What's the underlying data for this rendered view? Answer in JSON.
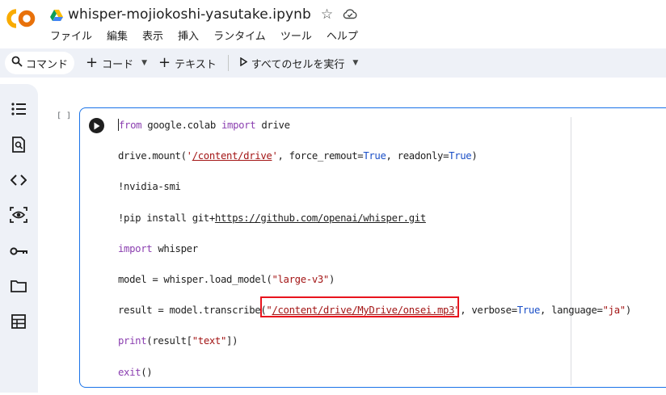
{
  "app": {
    "logo_text": "CO",
    "notebook_title": "whisper-mojiokoshi-yasutake.ipynb"
  },
  "menu": [
    "ファイル",
    "編集",
    "表示",
    "挿入",
    "ランタイム",
    "ツール",
    "ヘルプ"
  ],
  "toolbar": {
    "command_label": "コマンド",
    "add_code_label": "コード",
    "add_text_label": "テキスト",
    "run_all_label": "すべてのセルを実行"
  },
  "sidebar": {
    "icons": [
      "toc-icon",
      "find-icon",
      "code-snippets-icon",
      "variables-icon",
      "secrets-key-icon",
      "folder-icon",
      "data-table-icon"
    ]
  },
  "cell": {
    "bracket": "[ ]",
    "code_lines": [
      "from google.colab import drive",
      "drive.mount('/content/drive', force_remout=True, readonly=True)",
      "!nvidia-smi",
      "!pip install git+https://github.com/openai/whisper.git",
      "import whisper",
      "model = whisper.load_model(\"large-v3\")",
      "result = model.transcribe(\"/content/drive/MyDrive/onsei.mp3\", verbose=True, language=\"ja\")",
      "print(result[\"text\"])",
      "exit()"
    ]
  },
  "colors": {
    "accent": "#1a73e8",
    "keyword": "#8b3fb0",
    "string": "#a31515",
    "constant": "#1a4fc7",
    "highlight_box": "#e8141d",
    "logo_orange": "#f9ab00"
  }
}
